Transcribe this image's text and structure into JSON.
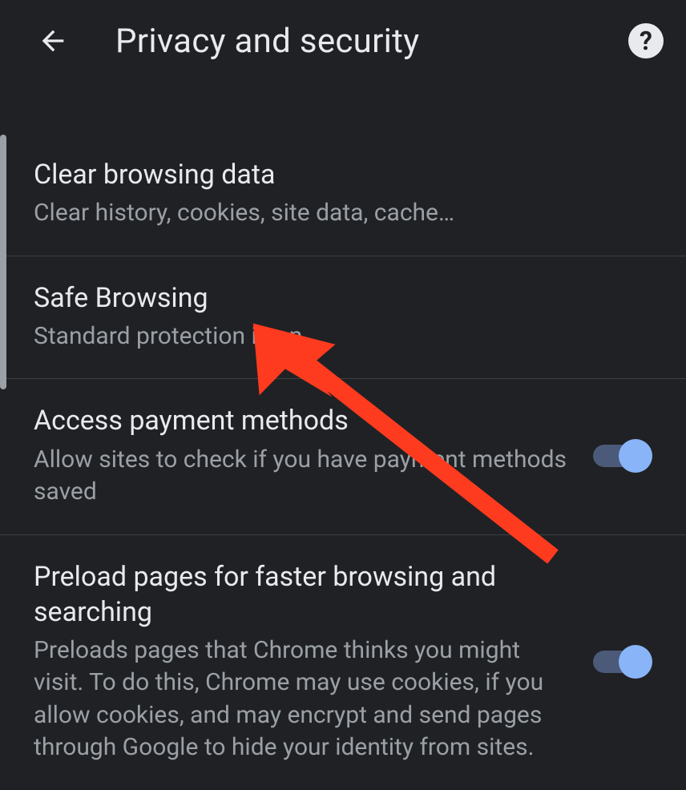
{
  "header": {
    "title": "Privacy and security"
  },
  "settings": {
    "clear_browsing": {
      "title": "Clear browsing data",
      "subtitle": "Clear history, cookies, site data, cache…"
    },
    "safe_browsing": {
      "title": "Safe Browsing",
      "subtitle": "Standard protection is on"
    },
    "payment_methods": {
      "title": "Access payment methods",
      "subtitle": "Allow sites to check if you have payment methods saved"
    },
    "preload_pages": {
      "title": "Preload pages for faster browsing and searching",
      "subtitle": "Preloads pages that Chrome thinks you might visit. To do this, Chrome may use cookies, if you allow cookies, and may encrypt and send pages through Google to hide your identity from sites."
    }
  }
}
